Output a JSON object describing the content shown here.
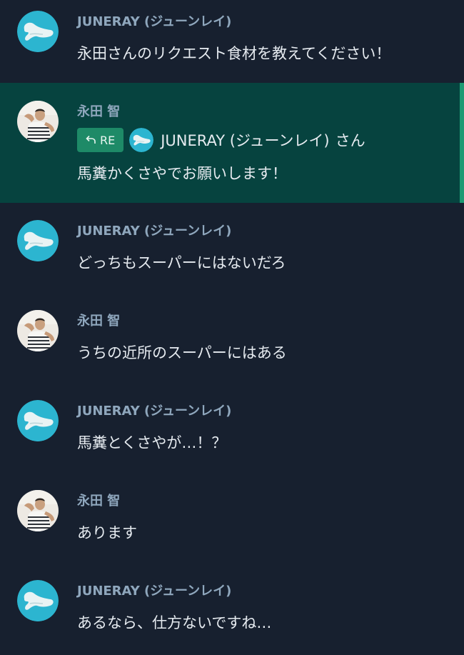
{
  "messages": [
    {
      "id": "m1",
      "avatar": "bot-logo-icon",
      "name": "JUNERAY (ジューンレイ)",
      "text": "永田さんのリクエスト食材を教えてください！"
    },
    {
      "id": "m2",
      "avatar": "user-photo",
      "name": "永田 智",
      "reply_badge": "RE",
      "reply_to": "JUNERAY (ジューンレイ)",
      "reply_suffix": "さん",
      "text": "馬糞かくさやでお願いします！",
      "highlighted": true
    },
    {
      "id": "m3",
      "avatar": "bot-logo-icon",
      "name": "JUNERAY (ジューンレイ)",
      "text": "どっちもスーパーにはないだろ"
    },
    {
      "id": "m4",
      "avatar": "user-photo",
      "name": "永田 智",
      "text": "うちの近所のスーパーにはある"
    },
    {
      "id": "m5",
      "avatar": "bot-logo-icon",
      "name": "JUNERAY (ジューンレイ)",
      "text": "馬糞とくさやが…！？"
    },
    {
      "id": "m6",
      "avatar": "user-photo",
      "name": "永田 智",
      "text": "あります"
    },
    {
      "id": "m7",
      "avatar": "bot-logo-icon",
      "name": "JUNERAY (ジューンレイ)",
      "text": "あるなら、仕方ないですね…"
    }
  ],
  "colors": {
    "background": "#17202f",
    "highlight_background": "#06433f",
    "highlight_bar": "#1d9a73",
    "re_badge": "#1e8a67",
    "name_text": "#8fa7bd",
    "message_text": "#e6ebf0",
    "bot_logo_bg": "#2bb3cf"
  }
}
